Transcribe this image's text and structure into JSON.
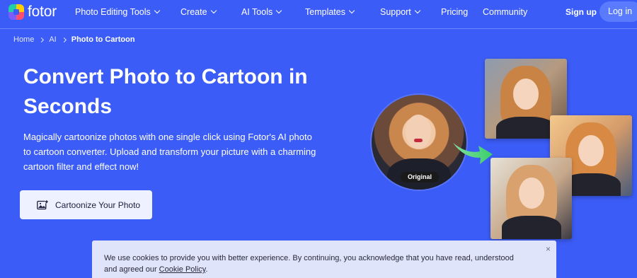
{
  "nav": {
    "logo_text": "fotor",
    "items": [
      {
        "label": "Photo Editing Tools",
        "has_dropdown": true
      },
      {
        "label": "Create",
        "has_dropdown": true
      },
      {
        "label": "AI Tools",
        "has_dropdown": true
      },
      {
        "label": "Templates",
        "has_dropdown": true
      },
      {
        "label": "Support",
        "has_dropdown": true
      },
      {
        "label": "Pricing",
        "has_dropdown": false
      },
      {
        "label": "Community",
        "has_dropdown": false
      }
    ],
    "signup_label": "Sign up",
    "login_label": "Log in"
  },
  "breadcrumb": {
    "items": [
      "Home",
      "AI"
    ],
    "current": "Photo to Cartoon"
  },
  "hero": {
    "title": "Convert Photo to Cartoon in Seconds",
    "description": "Magically cartoonize photos with one single click using Fotor's AI photo to cartoon converter. Upload and transform your picture with a charming cartoon filter and effect now!",
    "cta_label": "Cartoonize Your Photo",
    "cta_icon": "image-add-icon"
  },
  "illustration": {
    "original_badge": "Original",
    "arrow_icon": "arrow-right-icon"
  },
  "cookie": {
    "text": "We use cookies to provide you with better experience. By continuing, you acknowledge that you have read, understood and agreed our ",
    "link_label": "Cookie Policy",
    "suffix": ".",
    "close_icon": "×"
  },
  "colors": {
    "background": "#3b5cf6",
    "login_button": "#5b7bff",
    "cta_background": "#eef1ff",
    "cookie_background": "#dfe4fb"
  }
}
